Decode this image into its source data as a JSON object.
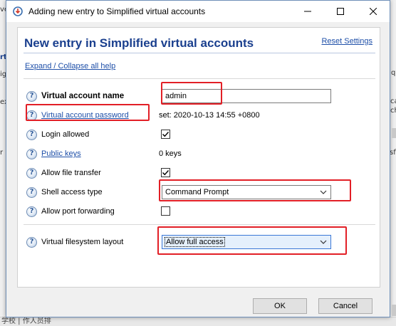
{
  "window": {
    "title": "Adding new entry to Simplified virtual accounts",
    "minimize_icon": "minimize-icon",
    "maximize_icon": "maximize-icon",
    "close_icon": "close-icon"
  },
  "background": {
    "frag_left_1": "ve",
    "frag_left_2": "rt",
    "frag_left_3": "ig",
    "frag_left_4": "ex",
    "frag_left_5": "r",
    "frag_right_1": "q",
    "frag_right_2": "ca",
    "frag_right_3": "ch",
    "frag_right_4": "sf",
    "bottom_text": "学校 | 作人员排"
  },
  "panel": {
    "title": "New entry in Simplified virtual accounts",
    "reset_label": "Reset Settings",
    "expand_label": "Expand / Collapse all help"
  },
  "fields": {
    "account_name_label": "Virtual account name",
    "account_name_value": "admin",
    "password_label": "Virtual account password",
    "password_status": "set:  2020-10-13 14:55 +0800",
    "login_allowed_label": "Login allowed",
    "login_allowed_checked": true,
    "public_keys_label": "Public keys",
    "public_keys_value": "0 keys",
    "file_transfer_label": "Allow file transfer",
    "file_transfer_checked": true,
    "shell_access_label": "Shell access type",
    "shell_access_value": "Command Prompt",
    "port_forwarding_label": "Allow port forwarding",
    "port_forwarding_checked": false,
    "fs_layout_label": "Virtual filesystem layout",
    "fs_layout_value": "Allow full access"
  },
  "buttons": {
    "ok": "OK",
    "cancel": "Cancel"
  },
  "colors": {
    "title_blue": "#1a3f8e",
    "link_blue": "#1e4fa8",
    "highlight_red": "#e21f26"
  }
}
